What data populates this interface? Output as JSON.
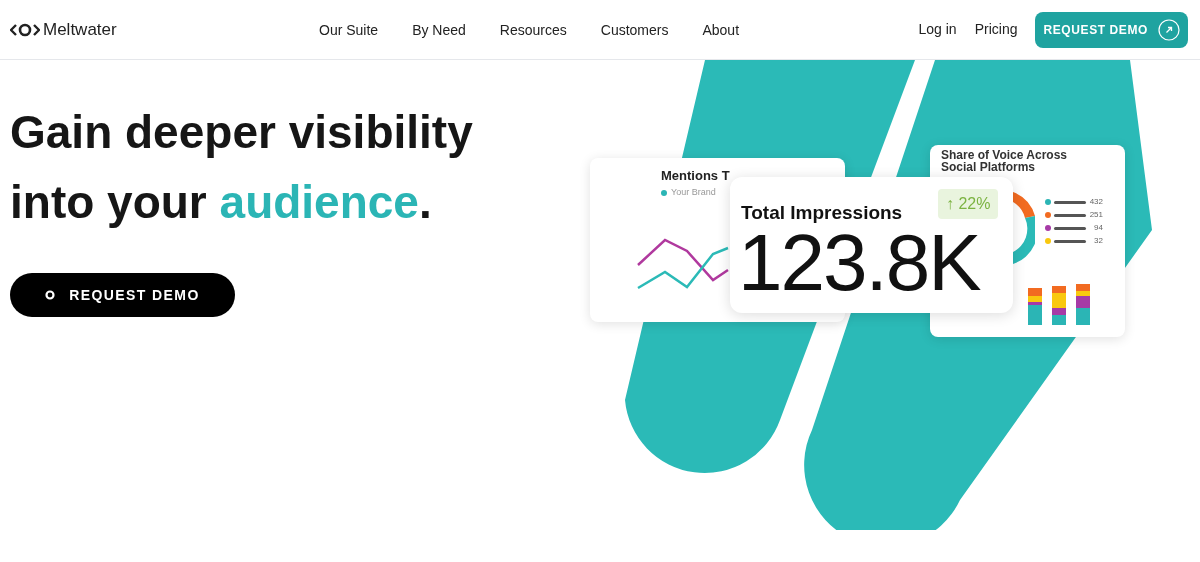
{
  "header": {
    "logo": "Meltwater",
    "nav": [
      {
        "label": "Our Suite"
      },
      {
        "label": "By Need"
      },
      {
        "label": "Resources"
      },
      {
        "label": "Customers"
      },
      {
        "label": "About"
      }
    ],
    "links": [
      {
        "label": "Log in"
      },
      {
        "label": "Pricing"
      }
    ],
    "cta": "REQUEST DEMO"
  },
  "hero": {
    "headline": [
      {
        "text": "Gain deeper visibility into your ",
        "accent": false
      },
      {
        "text": "audience",
        "accent": true
      },
      {
        "text": ".",
        "accent": false
      }
    ],
    "cta": "REQUEST DEMO"
  },
  "dashboard": {
    "mentions_card": {
      "title": "Mentions T",
      "legend": [
        {
          "label": "Your Brand",
          "color": "#2bb5b5"
        }
      ]
    },
    "impressions_card": {
      "title": "Total Impressions",
      "change": "↑ 22%",
      "value": "123.8K"
    },
    "share_card": {
      "title": "Share of Voice Across",
      "subtitle": "Social Platforms",
      "legend": [
        {
          "value": "432",
          "color": "#2bb5b5"
        },
        {
          "value": "251",
          "color": "#f26b21"
        },
        {
          "value": "94",
          "color": "#a63aa6"
        },
        {
          "value": "32",
          "color": "#f9c80e"
        }
      ]
    }
  }
}
